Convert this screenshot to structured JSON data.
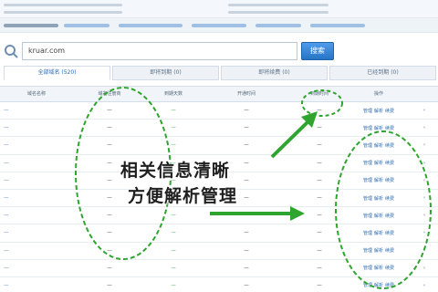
{
  "search": {
    "value": "kruar.com",
    "button_label": "搜索"
  },
  "tabs": [
    {
      "label": "全部域名 (520)"
    },
    {
      "label": "即将到期 (0)"
    },
    {
      "label": "即将续费 (0)"
    },
    {
      "label": "已经到期 (0)"
    }
  ],
  "table": {
    "columns": [
      "域名名称",
      "域名注册商",
      "到期天数",
      "开通时间",
      "到期时间",
      "操作"
    ],
    "rows": [
      {
        "domain": "—",
        "registrar": "—",
        "days": "—",
        "open": "—",
        "expire": "—"
      },
      {
        "domain": "—",
        "registrar": "—",
        "days": "—",
        "open": "—",
        "expire": "—"
      },
      {
        "domain": "—",
        "registrar": "—",
        "days": "—",
        "open": "—",
        "expire": "—"
      },
      {
        "domain": "—",
        "registrar": "—",
        "days": "—",
        "open": "—",
        "expire": "—"
      },
      {
        "domain": "—",
        "registrar": "—",
        "days": "—",
        "open": "—",
        "expire": "—"
      },
      {
        "domain": "—",
        "registrar": "—",
        "days": "—",
        "open": "—",
        "expire": "—"
      },
      {
        "domain": "—",
        "registrar": "—",
        "days": "—",
        "open": "—",
        "expire": "—"
      },
      {
        "domain": "—",
        "registrar": "—",
        "days": "—",
        "open": "—",
        "expire": "—"
      },
      {
        "domain": "—",
        "registrar": "—",
        "days": "—",
        "open": "—",
        "expire": "—"
      },
      {
        "domain": "—",
        "registrar": "—",
        "days": "—",
        "open": "—",
        "expire": "—"
      },
      {
        "domain": "—",
        "registrar": "—",
        "days": "—",
        "open": "—",
        "expire": "—"
      }
    ],
    "action_labels": [
      "管理",
      "解析",
      "续费"
    ],
    "more_label": "»"
  },
  "annotation": {
    "line1": "相关信息清晰",
    "line2": "方便解析管理",
    "color": "#2fa52f"
  },
  "colors": {
    "accent": "#2b6cb0",
    "link": "#3b73c4",
    "days": "#2f9a3c",
    "annotation": "#2fa52f"
  }
}
